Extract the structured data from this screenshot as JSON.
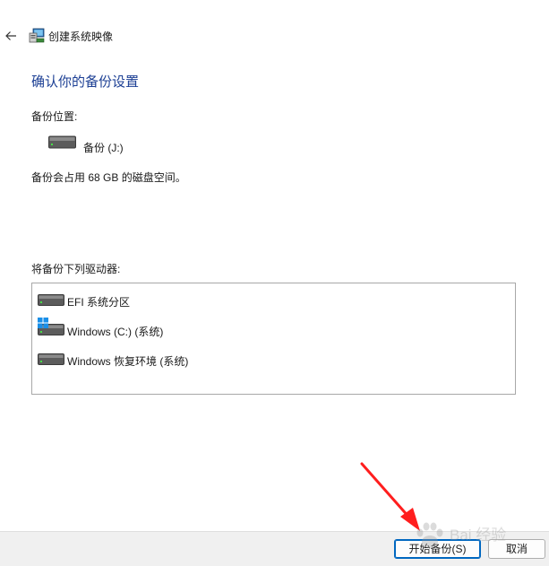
{
  "window": {
    "title": "创建系统映像",
    "back_icon": "arrow-left-icon",
    "app_icon": "backup-computer-icon"
  },
  "main": {
    "heading": "确认你的备份设置",
    "backup_location_label": "备份位置:",
    "backup_location_drive": "备份 (J:)",
    "space_text": "备份会占用 68 GB 的磁盘空间。",
    "drives_label": "将备份下列驱动器:",
    "drives": [
      {
        "label": "EFI 系统分区",
        "icon": "hard-drive-icon"
      },
      {
        "label": "Windows (C:) (系统)",
        "icon": "windows-hard-drive-icon"
      },
      {
        "label": "Windows 恢复环境 (系统)",
        "icon": "hard-drive-icon"
      }
    ]
  },
  "footer": {
    "start_button": "开始备份(S)",
    "cancel_button": "取消"
  },
  "watermark": {
    "text": "Bai 经验"
  },
  "colors": {
    "heading": "#1c3f94",
    "annotation_arrow": "#ff1e1e",
    "footer_bg": "#f0f0f0",
    "primary_border": "#0067c0"
  }
}
